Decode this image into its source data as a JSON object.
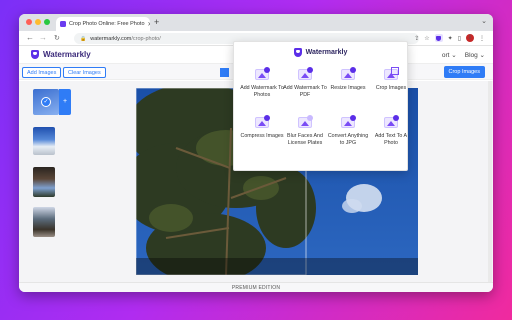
{
  "browser": {
    "tab_title": "Crop Photo Online: Free Photo",
    "tab_close": "✕",
    "new_tab": "+",
    "url_domain": "watermarkly.com",
    "url_path": "/crop-photo/",
    "back": "←",
    "forward": "→",
    "reload": "C",
    "avatar_initial": "I"
  },
  "site": {
    "brand": "Watermarkly",
    "nav": [
      "ort ⌄",
      "Blog ⌄"
    ]
  },
  "toolbar": {
    "add_images": "Add Images",
    "clear_images": "Clear Images",
    "crop_images": "Crop Images"
  },
  "popup": {
    "title": "Watermarkly",
    "items": [
      {
        "label": "Add Watermark To Photos",
        "icon": "watermark-photos-icon"
      },
      {
        "label": "Add Watermark To PDF",
        "icon": "watermark-pdf-icon"
      },
      {
        "label": "Resize Images",
        "icon": "resize-icon"
      },
      {
        "label": "Crop Images",
        "icon": "crop-icon"
      },
      {
        "label": "Compress Images",
        "icon": "compress-icon"
      },
      {
        "label": "Blur Faces And License Plates",
        "icon": "blur-faces-icon"
      },
      {
        "label": "Convert Anything to JPG",
        "icon": "convert-jpg-icon"
      },
      {
        "label": "Add Text To A Photo",
        "icon": "add-text-icon"
      }
    ]
  },
  "footer": {
    "text": "PREMIUM EDITION"
  },
  "colors": {
    "accent": "#2f7cf6",
    "brand": "#5b2ee8"
  }
}
